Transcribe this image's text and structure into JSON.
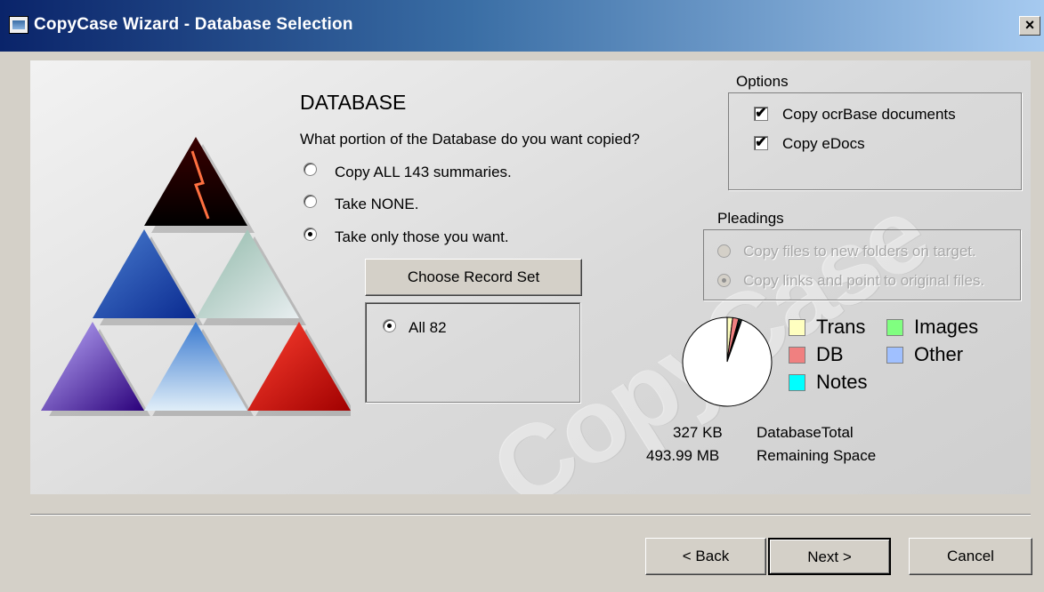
{
  "window": {
    "title": "CopyCase Wizard - Database Selection",
    "close_label": "×"
  },
  "watermark": "CopyCase",
  "database": {
    "heading": "DATABASE",
    "question": "What portion of the Database do you want copied?",
    "options": [
      {
        "label": "Copy ALL 143  summaries.",
        "selected": false
      },
      {
        "label": "Take NONE.",
        "selected": false
      },
      {
        "label": "Take only those you want.",
        "selected": true
      }
    ],
    "choose_button": "Choose Record Set",
    "record_set": {
      "label": "All 82",
      "selected": true
    }
  },
  "options_group": {
    "title": "Options",
    "items": [
      {
        "label": "Copy ocrBase documents",
        "checked": true,
        "mark": "✔"
      },
      {
        "label": "Copy eDocs",
        "checked": true,
        "mark": "✔"
      }
    ]
  },
  "pleadings_group": {
    "title": "Pleadings",
    "items": [
      {
        "label": "Copy files to new folders on target.",
        "selected": false,
        "enabled": false
      },
      {
        "label": "Copy links and point to original files.",
        "selected": true,
        "enabled": false
      }
    ]
  },
  "chart_data": {
    "type": "pie",
    "slices": [
      {
        "name": "Trans",
        "value": 2.0,
        "color": "#ffffc0"
      },
      {
        "name": "DB",
        "value": 2.2,
        "color": "#f08080"
      },
      {
        "name": "Notes",
        "value": 0.4,
        "color": "#00ffff"
      },
      {
        "name": "Images",
        "value": 0.4,
        "color": "#80ff80"
      },
      {
        "name": "Other",
        "value": 0.4,
        "color": "#a0c0ff"
      },
      {
        "name": "",
        "value": 94.6,
        "color": "#ffffff"
      }
    ],
    "legend": [
      "Trans",
      "Images",
      "DB",
      "Other",
      "Notes"
    ]
  },
  "stats": {
    "db_total_value": "327 KB",
    "db_total_label": "DatabaseTotal",
    "remaining_value": "493.99 MB",
    "remaining_label": "Remaining Space"
  },
  "buttons": {
    "back": "< Back",
    "next": "Next >",
    "cancel": "Cancel"
  }
}
